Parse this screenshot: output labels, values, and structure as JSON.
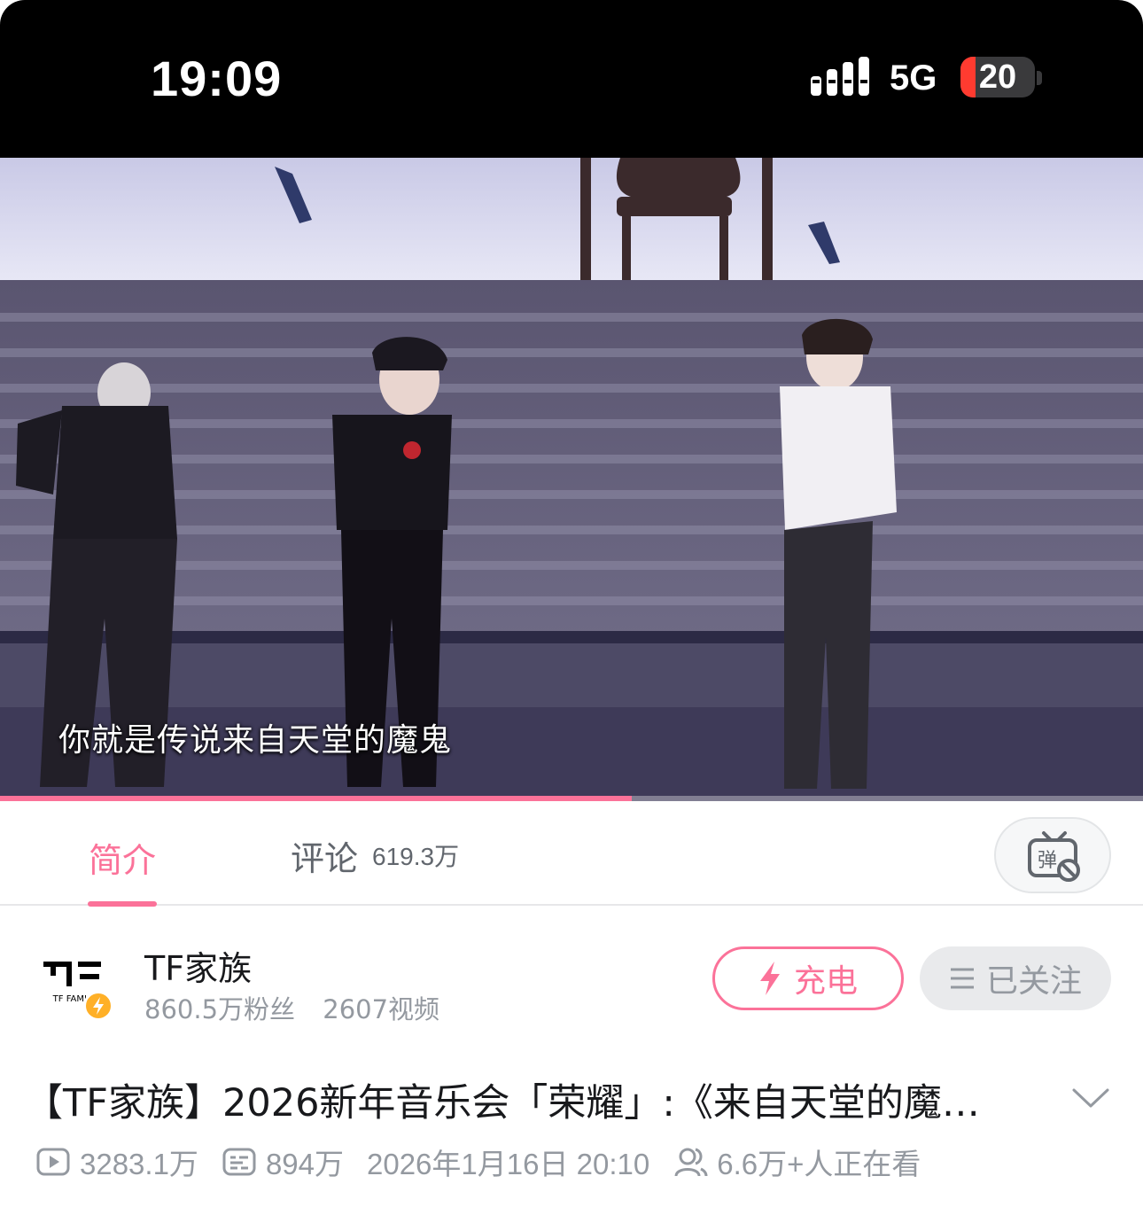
{
  "status_bar": {
    "time": "19:09",
    "network": "5G",
    "battery_level": "20",
    "battery_fraction": 0.2,
    "icons": [
      "signal-bars-icon",
      "battery-icon"
    ]
  },
  "video": {
    "subtitle": "你就是传说来自天堂的魔鬼",
    "progress_fraction": 0.553,
    "accent_color": "#fb7299"
  },
  "tabs": {
    "intro": "简介",
    "comments": "评论",
    "comments_count": "619.3万",
    "danmaku_icon": "danmaku-toggle-icon"
  },
  "uploader": {
    "name": "TF家族",
    "followers": "860.5万粉丝",
    "videos": "2607视频",
    "logo_text": "TF FAMILY",
    "charge_label": "充电",
    "follow_label": "已关注"
  },
  "video_info": {
    "title": "【TF家族】2026新年音乐会「荣耀」:《来自天堂的魔…",
    "views": "3283.1万",
    "danmaku_count": "894万",
    "publish_time": "2026年1月16日 20:10",
    "watching_now": "6.6万+人正在看"
  },
  "colors": {
    "brand_pink": "#fb7299",
    "text_primary": "#18191c",
    "text_secondary": "#9499a0"
  }
}
